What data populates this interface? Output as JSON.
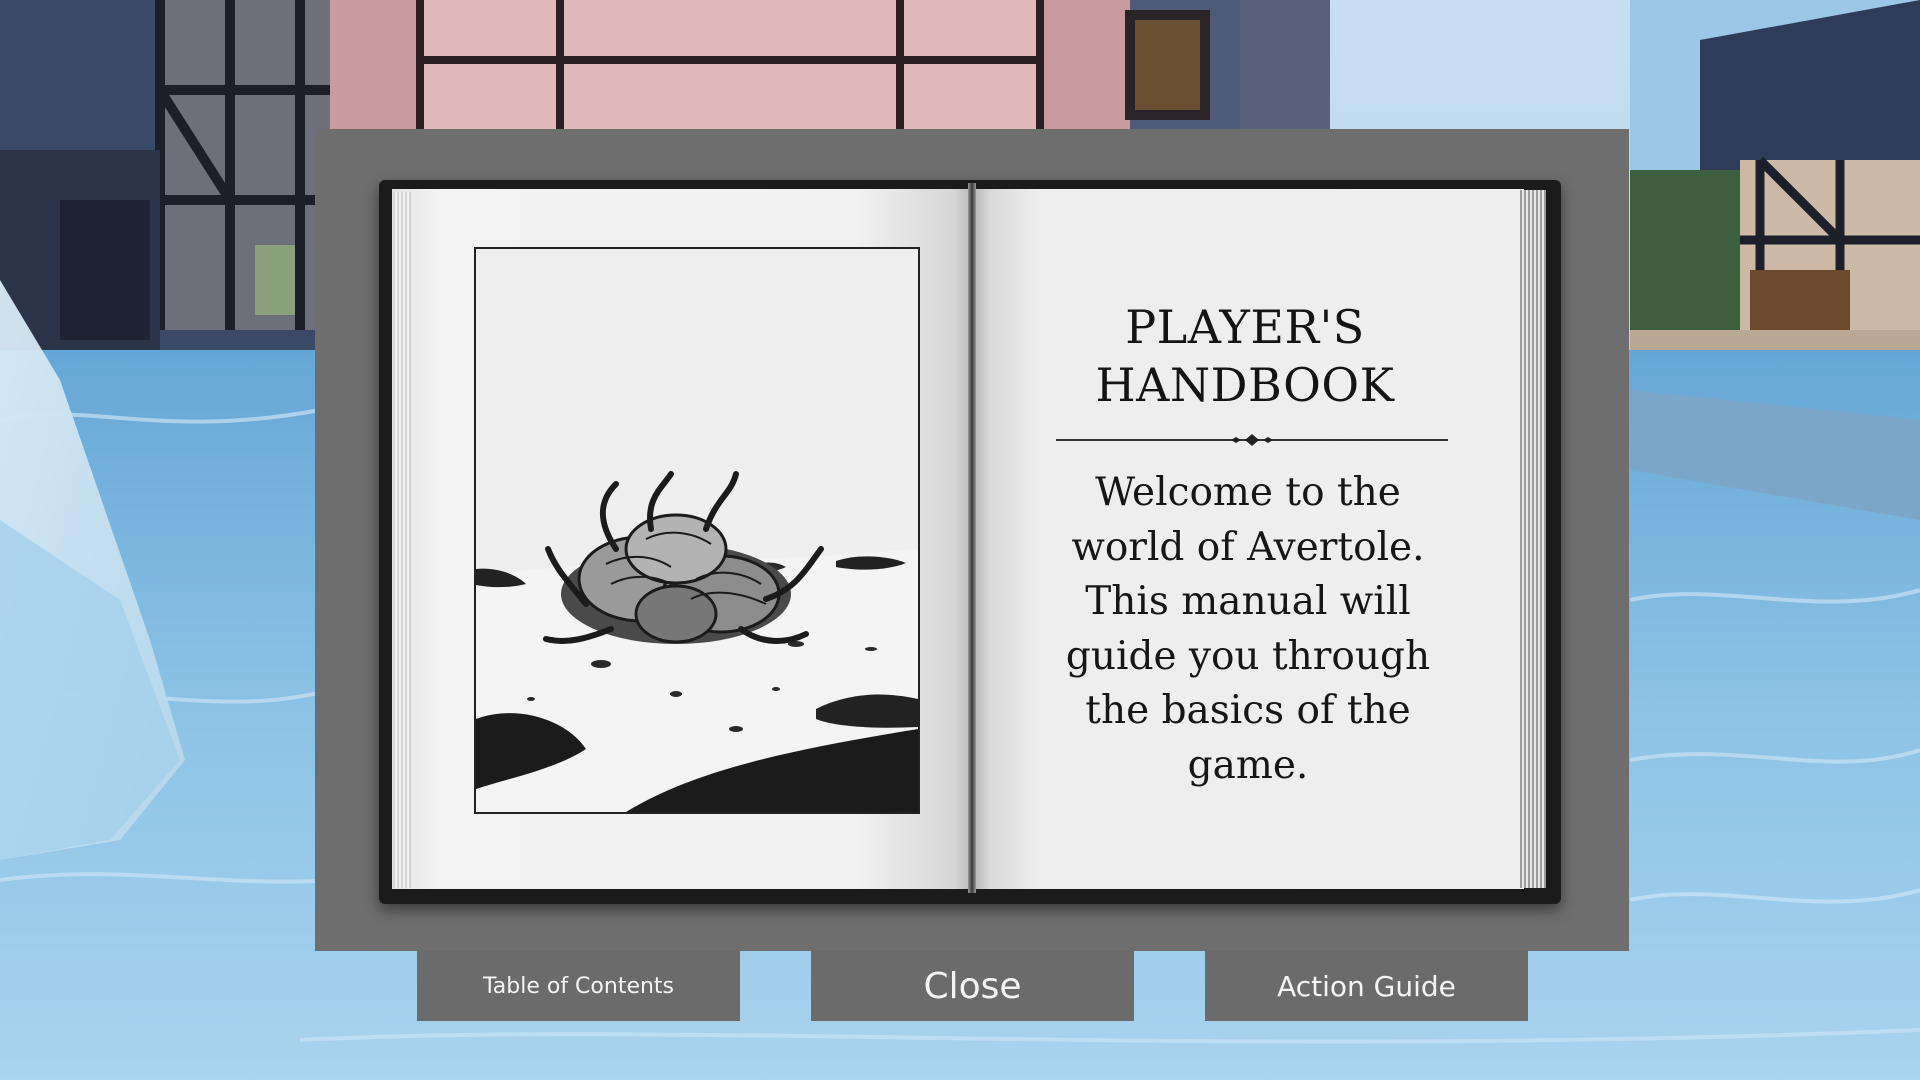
{
  "handbook": {
    "title": "PLAYER'S HANDBOOK",
    "welcome_text": "Welcome to the world of Avertole. This manual will guide you through the basics of the game.",
    "illustration_icon": "creature-illustration"
  },
  "buttons": {
    "table_of_contents": "Table of Contents",
    "close": "Close",
    "action_guide": "Action Guide"
  },
  "colors": {
    "panel": "#6e6e6e",
    "button": "#6b6b6b",
    "button_text": "#f4f4f4",
    "page": "#efefef",
    "ink": "#141414",
    "water": "#7fb6dc"
  }
}
